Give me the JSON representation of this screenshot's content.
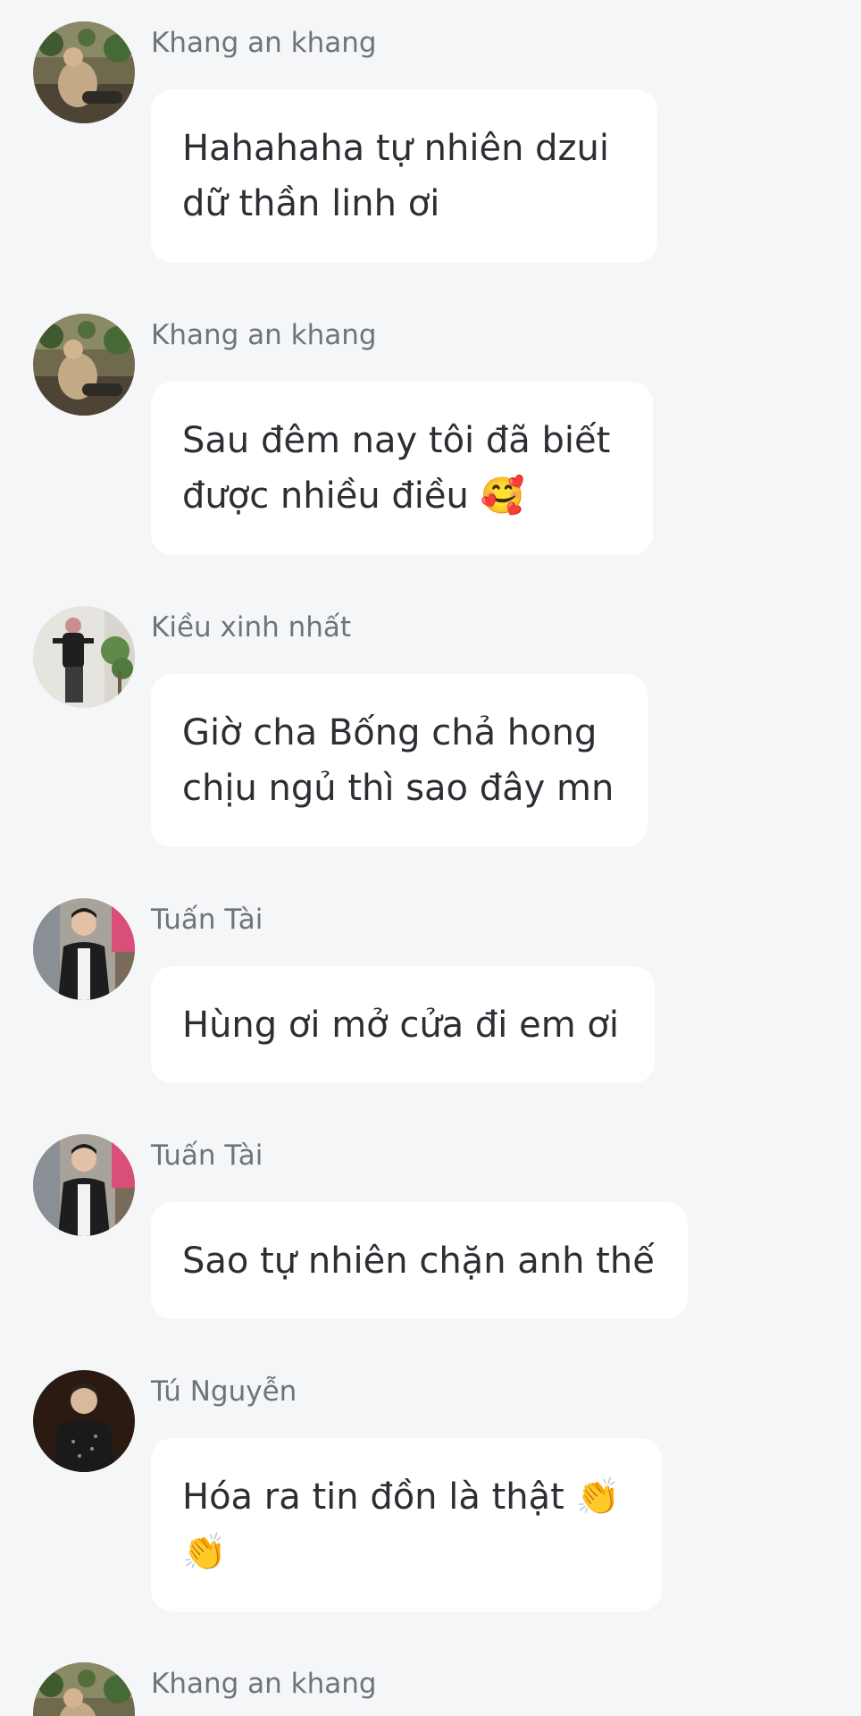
{
  "feed": {
    "messages": [
      {
        "author": "Khang an khang",
        "avatar": "avatar-khang-icon",
        "text": "Hahahaha tự nhiên dzui\ndữ thần linh ơi"
      },
      {
        "author": "Khang an khang",
        "avatar": "avatar-khang-icon",
        "text": "Sau đêm nay tôi đã biết\nđược nhiều điều 🥰"
      },
      {
        "author": "Kiều xinh nhất",
        "avatar": "avatar-kieu-icon",
        "text": "Giờ cha Bống chả hong\nchịu ngủ thì sao đây mn"
      },
      {
        "author": "Tuấn Tài",
        "avatar": "avatar-tuan-tai-icon",
        "text": "Hùng ơi mở cửa đi em ơi"
      },
      {
        "author": "Tuấn Tài",
        "avatar": "avatar-tuan-tai-icon",
        "text": "Sao tự nhiên chặn anh thế"
      },
      {
        "author": "Tú Nguyễn",
        "avatar": "avatar-tu-nguyen-icon",
        "text": "Hóa ra tin đồn là thật 👏\n👏"
      },
      {
        "author": "Khang an khang",
        "avatar": "avatar-khang-icon",
        "text": ""
      }
    ]
  },
  "colors": {
    "background": "#f5f6f8",
    "bubble": "#ffffff",
    "author_text": "#6f7479",
    "message_text": "#2b2e33"
  }
}
